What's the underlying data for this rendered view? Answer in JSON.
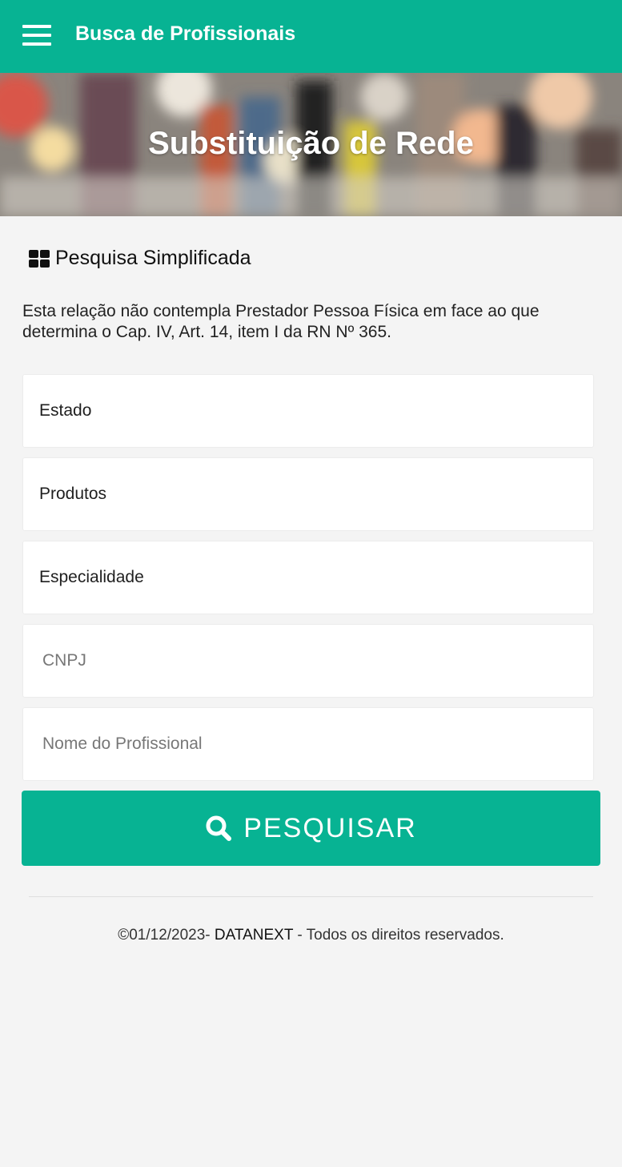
{
  "header": {
    "title": "Busca de Profissionais",
    "menu_icon": "hamburger-menu-icon",
    "background_color": "#07b393"
  },
  "hero": {
    "title": "Substituição de Rede"
  },
  "section": {
    "icon": "grid-icon",
    "title": "Pesquisa Simplificada"
  },
  "notice": "Esta relação não contempla Prestador Pessoa Física em face ao que determina o Cap. IV, Art. 14, item I da RN Nº 365.",
  "form": {
    "estado_label": "Estado",
    "produtos_label": "Produtos",
    "especialidade_label": "Especialidade",
    "cnpj_placeholder": "CNPJ",
    "nome_placeholder": "Nome do Profissional"
  },
  "search_button": {
    "icon": "search-icon",
    "label": "PESQUISAR",
    "background_color": "#07b393"
  },
  "footer": {
    "date_prefix": "©01/12/2023-",
    "brand": "DATANEXT",
    "suffix": "- Todos os direitos reservados."
  }
}
